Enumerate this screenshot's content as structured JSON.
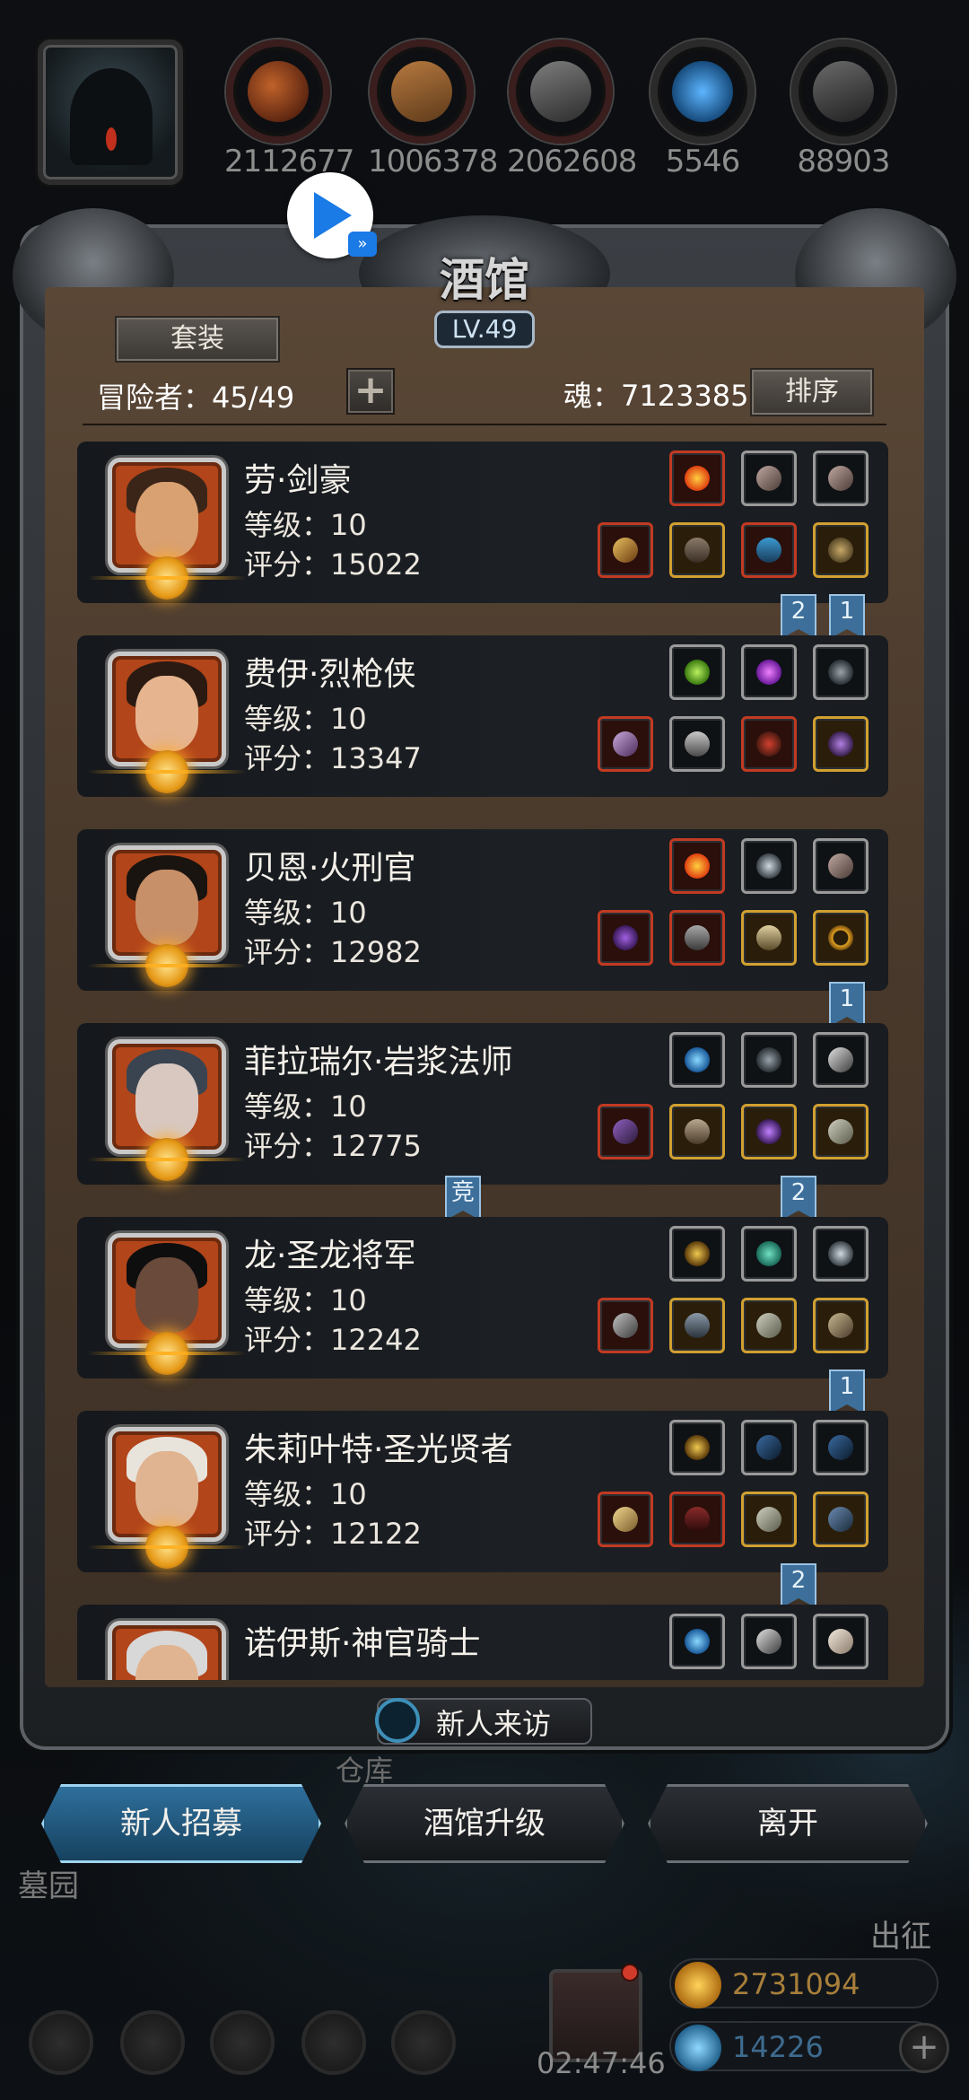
{
  "top_resources": [
    {
      "icon": "meat-icon",
      "value": "2112677"
    },
    {
      "icon": "wood-icon",
      "value": "1006378"
    },
    {
      "icon": "iron-icon",
      "value": "2062608"
    },
    {
      "icon": "crystal-icon",
      "value": "5546"
    },
    {
      "icon": "stone-icon",
      "value": "88903"
    }
  ],
  "tavern": {
    "title": "酒馆",
    "level": "LV.49",
    "set_button": "套装",
    "adventurers_label": "冒险者：45/49",
    "soul_label": "魂：7123385",
    "sort_button": "排序"
  },
  "heroes": [
    {
      "name": "劳·剑豪",
      "level": "等级：10",
      "score": "评分：15022"
    },
    {
      "name": "费伊·烈枪侠",
      "level": "等级：10",
      "score": "评分：13347"
    },
    {
      "name": "贝恩·火刑官",
      "level": "等级：10",
      "score": "评分：12982"
    },
    {
      "name": "菲拉瑞尔·岩浆法师",
      "level": "等级：10",
      "score": "评分：12775"
    },
    {
      "name": "龙·圣龙将军",
      "level": "等级：10",
      "score": "评分：12242"
    },
    {
      "name": "朱莉叶特·圣光贤者",
      "level": "等级：10",
      "score": "评分：12122"
    },
    {
      "name": "诺伊斯·神官骑士",
      "level": "",
      "score": ""
    }
  ],
  "ribbons": {
    "r1a": "2",
    "r1b": "1",
    "r3": "1",
    "r4a": "竞",
    "r4b": "2",
    "r5": "1",
    "r6": "2"
  },
  "visit_label": "新人来访",
  "scene_labels": {
    "warehouse": "仓库",
    "graveyard": "墓园",
    "expedition": "出征"
  },
  "actions": {
    "recruit": "新人招募",
    "upgrade": "酒馆升级",
    "leave": "离开"
  },
  "hud": {
    "timer": "02:47:46",
    "gold": "2731094",
    "crystal": "14226",
    "add": "+"
  },
  "colors": {
    "accent_blue": "#2f6f9c",
    "gold_text": "#a87f3a",
    "card_bg": "#1c2024"
  }
}
